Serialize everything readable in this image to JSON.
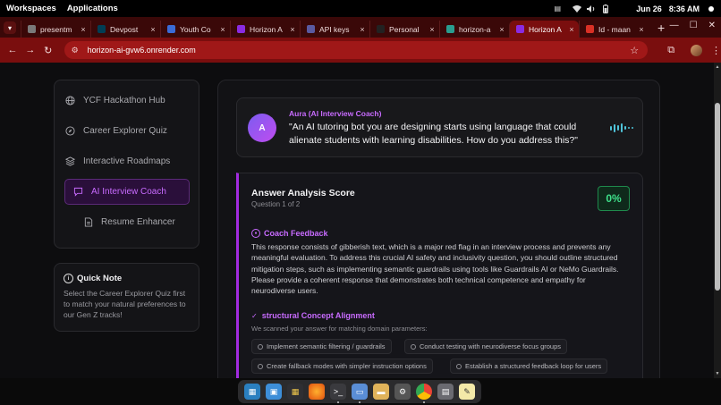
{
  "os": {
    "workspaces_label": "Workspaces",
    "applications_label": "Applications",
    "date": "Jun 26",
    "time": "8:36 AM"
  },
  "browser": {
    "tabs": [
      {
        "title": "presentm",
        "favicon": "globe-icon",
        "color": "#7a7a7a",
        "active": false
      },
      {
        "title": "Devpost",
        "favicon": "devpost-icon",
        "color": "#003e54",
        "active": false
      },
      {
        "title": "Youth Co",
        "favicon": "sparkle-icon",
        "color": "#3b6bd6",
        "active": false
      },
      {
        "title": "Horizon A",
        "favicon": "horizon-icon",
        "color": "#8a2be2",
        "active": false
      },
      {
        "title": "API keys",
        "favicon": "api-icon",
        "color": "#5a5aa0",
        "active": false
      },
      {
        "title": "Personal",
        "favicon": "github-icon",
        "color": "#222",
        "active": false
      },
      {
        "title": "horizon-a",
        "favicon": "render-icon",
        "color": "#2a9d8f",
        "active": false
      },
      {
        "title": "Horizon A",
        "favicon": "horizon-icon",
        "color": "#8a2be2",
        "active": true
      },
      {
        "title": "Id - maan",
        "favicon": "gmail-icon",
        "color": "#d93025",
        "active": false
      }
    ],
    "url": "horizon-ai-gvw6.onrender.com",
    "accent": "#7a0e0e"
  },
  "sidebar": {
    "items": [
      {
        "label": "YCF Hackathon Hub",
        "icon": "globe-icon"
      },
      {
        "label": "Career Explorer Quiz",
        "icon": "compass-icon"
      },
      {
        "label": "Interactive Roadmaps",
        "icon": "layers-icon"
      },
      {
        "label": "AI Interview Coach",
        "icon": "chat-icon",
        "active": true
      },
      {
        "label": "Resume Enhancer",
        "icon": "document-icon"
      }
    ]
  },
  "quick_note": {
    "title": "Quick Note",
    "text": "Select the Career Explorer Quiz first to match your natural preferences to our Gen Z tracks!"
  },
  "question": {
    "avatar_letter": "A",
    "coach_name": "Aura (AI Interview Coach)",
    "text": "\"An AI tutoring bot you are designing starts using language that could alienate students with learning disabilities. How do you address this?\""
  },
  "analysis": {
    "title": "Answer Analysis Score",
    "progress": "Question 1 of 2",
    "score": "0%",
    "feedback_title": "Coach Feedback",
    "feedback_text": "This response consists of gibberish text, which is a major red flag in an interview process and prevents any meaningful evaluation. To address this crucial AI safety and inclusivity question, you should outline structured mitigation steps, such as implementing semantic guardrails using tools like Guardrails AI or NeMo Guardrails. Please provide a coherent response that demonstrates both technical competence and empathy for neurodiverse users.",
    "concept_title": "structural Concept Alignment",
    "concept_sub": "We scanned your answer for matching domain parameters:",
    "concepts": [
      "Implement semantic filtering / guardrails",
      "Conduct testing with neurodiverse focus groups",
      "Create fallback modes with simpler instruction options",
      "Establish a structured feedback loop for users"
    ]
  },
  "colors": {
    "accent_purple": "#c86bff",
    "score_green": "#3fe08a"
  }
}
